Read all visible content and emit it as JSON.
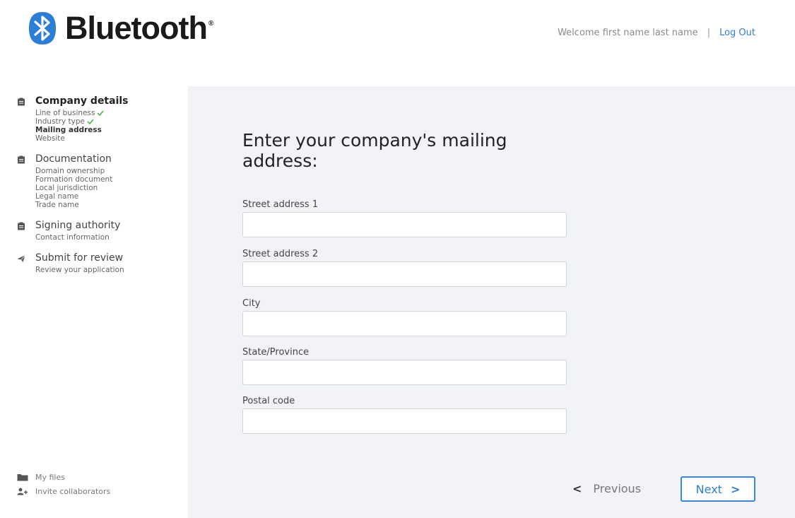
{
  "brand": {
    "name": "Bluetooth",
    "reg_mark": "®",
    "color": "#2d7fd6"
  },
  "header": {
    "welcome": "Welcome first name last name",
    "separator": "|",
    "logout": "Log Out"
  },
  "sidebar": {
    "sections": [
      {
        "title": "Company details",
        "icon": "clipboard-icon",
        "items": [
          {
            "label": "Line of business",
            "done": true
          },
          {
            "label": "Industry type",
            "done": true
          },
          {
            "label": "Mailing address",
            "current": true
          },
          {
            "label": "Website"
          }
        ]
      },
      {
        "title": "Documentation",
        "icon": "clipboard-icon",
        "items": [
          {
            "label": "Domain ownership"
          },
          {
            "label": "Formation document"
          },
          {
            "label": "Local jurisdiction"
          },
          {
            "label": "Legal name"
          },
          {
            "label": "Trade name"
          }
        ]
      },
      {
        "title": "Signing authority",
        "icon": "clipboard-icon",
        "items": [
          {
            "label": "Contact information"
          }
        ]
      },
      {
        "title": "Submit for review",
        "icon": "paper-plane-icon",
        "items": [
          {
            "label": "Review your application"
          }
        ]
      }
    ],
    "bottom": [
      {
        "label": "My files",
        "icon": "folder-icon"
      },
      {
        "label": "Invite collaborators",
        "icon": "add-user-icon"
      }
    ]
  },
  "form": {
    "title": "Enter your company's mailing address:",
    "fields": [
      {
        "label": "Street address 1",
        "value": ""
      },
      {
        "label": "Street address 2",
        "value": ""
      },
      {
        "label": "City",
        "value": ""
      },
      {
        "label": "State/Province",
        "value": ""
      },
      {
        "label": "Postal code",
        "value": ""
      }
    ],
    "previous": "Previous",
    "next": "Next",
    "prev_chevron": "<",
    "next_chevron": ">"
  },
  "colors": {
    "accent": "#2d7fd6",
    "check": "#5cb85c",
    "panel_bg": "#f2f3f7"
  }
}
